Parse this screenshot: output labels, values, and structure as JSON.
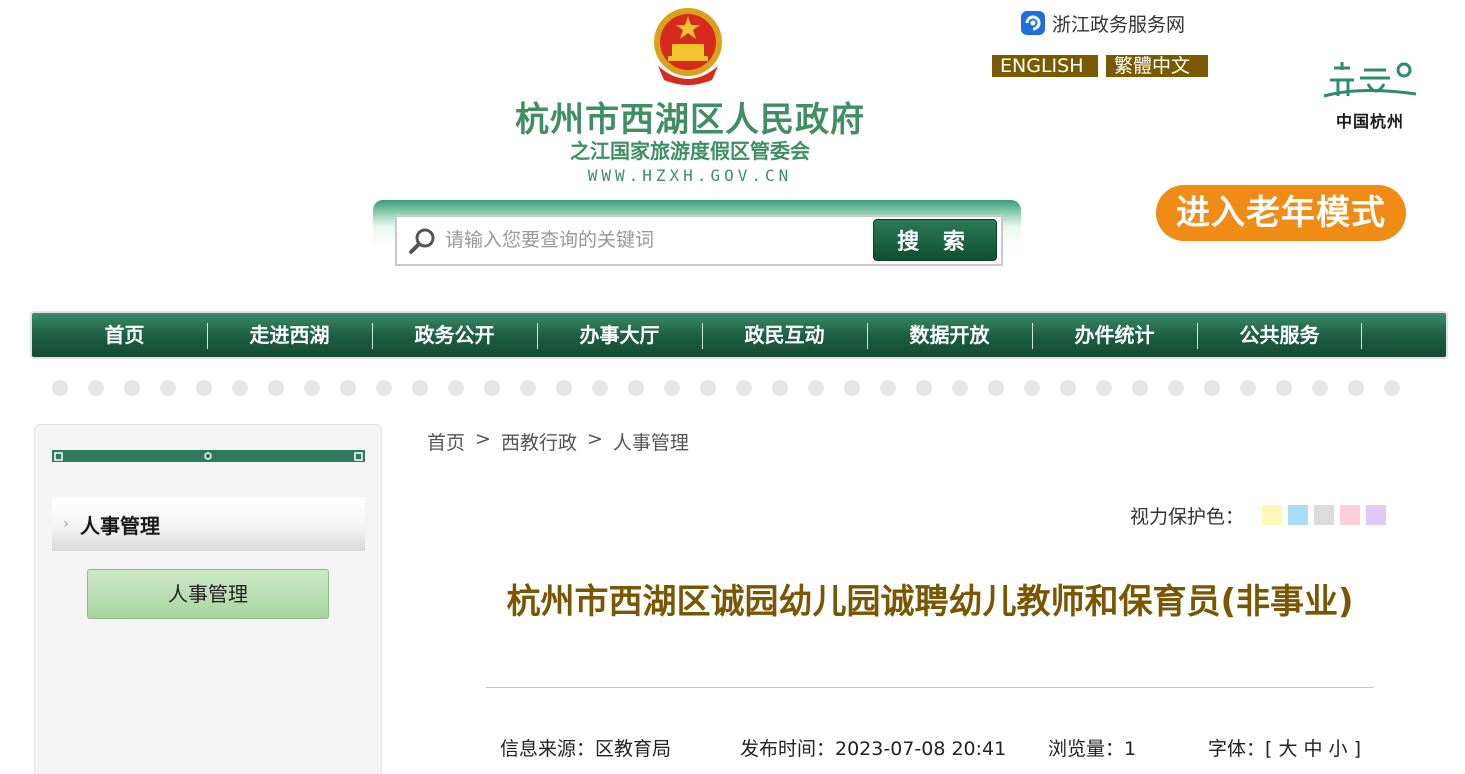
{
  "header": {
    "site_title": "杭州市西湖区人民政府",
    "site_subtitle": "之江国家旅游度假区管委会",
    "site_url": "WWW.HZXH.GOV.CN",
    "zj_link_label": "浙江政务服务网",
    "lang_en": "ENGLISH",
    "lang_tw": "繁體中文",
    "city_logo_text": "中国杭州",
    "elder_mode_label": "进入老年模式"
  },
  "search": {
    "placeholder": "请输入您要查询的关键词",
    "button_label": "搜 索"
  },
  "nav": {
    "items": [
      "首页",
      "走进西湖",
      "政务公开",
      "办事大厅",
      "政民互动",
      "数据开放",
      "办件统计",
      "公共服务"
    ]
  },
  "sidebar": {
    "title": "人事管理",
    "button_label": "人事管理"
  },
  "breadcrumb": {
    "items": [
      "首页",
      "西教行政",
      "人事管理"
    ],
    "separator": ">"
  },
  "eye_protect": {
    "label": "视力保护色：",
    "colors": [
      "#fff8b8",
      "#a9dcf5",
      "#dcdcdc",
      "#ffd0dc",
      "#e2c8f5"
    ]
  },
  "article": {
    "title": "杭州市西湖区诚园幼儿园诚聘幼儿教师和保育员(非事业)",
    "source": "信息来源：区教育局",
    "time": "发布时间：2023-07-08 20:41",
    "views": "浏览量：1",
    "font": "字体：[ 大 中 小 ]"
  },
  "colors": {
    "brand_green": "#3f8f62",
    "nav_dark": "#1c5c42",
    "title_brown": "#7a5600",
    "elder_orange": "#f08c16",
    "lang_brown": "#7a5a00"
  }
}
